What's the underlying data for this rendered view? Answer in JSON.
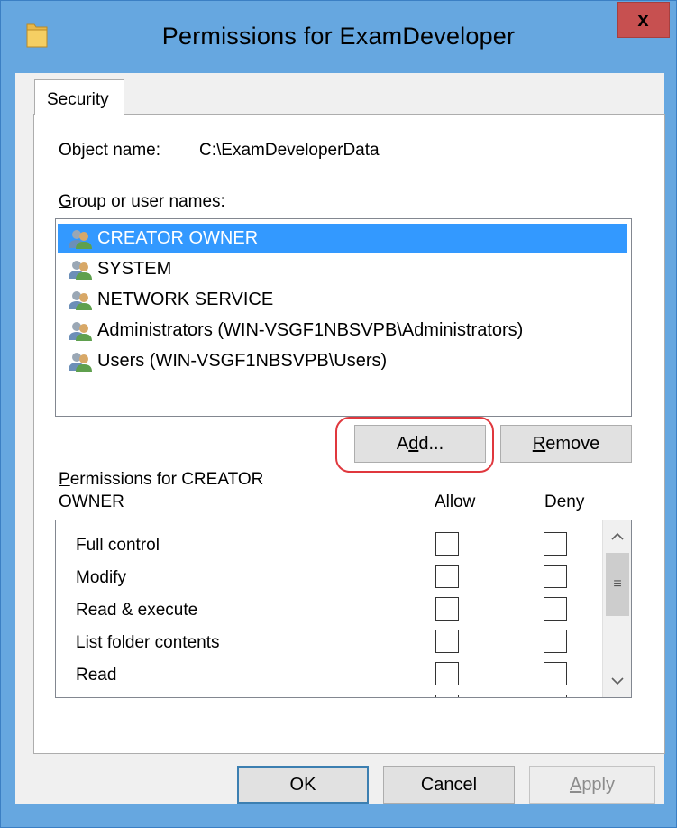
{
  "window": {
    "title": "Permissions for ExamDeveloper",
    "close_glyph": "x",
    "folder_icon": "folder-icon"
  },
  "tab": {
    "label": "Security"
  },
  "object": {
    "label": "Object name:",
    "value": "C:\\ExamDeveloperData"
  },
  "groups": {
    "label_hotkey": "G",
    "label_rest": "roup or user names:",
    "items": [
      {
        "name": "CREATOR OWNER",
        "selected": true
      },
      {
        "name": "SYSTEM",
        "selected": false
      },
      {
        "name": "NETWORK SERVICE",
        "selected": false
      },
      {
        "name": "Administrators (WIN-VSGF1NBSVPB\\Administrators)",
        "selected": false
      },
      {
        "name": "Users (WIN-VSGF1NBSVPB\\Users)",
        "selected": false
      }
    ],
    "item_icon": "users-group-icon"
  },
  "buttons": {
    "add_pre": "A",
    "add_hotkey": "d",
    "add_post": "d...",
    "remove_hotkey": "R",
    "remove_rest": "emove",
    "ok": "OK",
    "cancel": "Cancel",
    "apply_hotkey": "A",
    "apply_rest": "pply"
  },
  "permissions": {
    "title_hotkey": "P",
    "title_line1": "ermissions for CREATOR",
    "title_line2": "OWNER",
    "allow_header": "Allow",
    "deny_header": "Deny",
    "rows": [
      {
        "name": "Full control",
        "allow": false,
        "deny": false
      },
      {
        "name": "Modify",
        "allow": false,
        "deny": false
      },
      {
        "name": "Read & execute",
        "allow": false,
        "deny": false
      },
      {
        "name": "List folder contents",
        "allow": false,
        "deny": false
      },
      {
        "name": "Read",
        "allow": false,
        "deny": false
      }
    ],
    "scroll_up_glyph": "^",
    "scroll_down_glyph": "v",
    "thumb_glyph": "≡"
  },
  "colors": {
    "titlebar": "#66a7e0",
    "close": "#c75050",
    "selection": "#3399ff",
    "highlight_ring": "#e0383e"
  }
}
